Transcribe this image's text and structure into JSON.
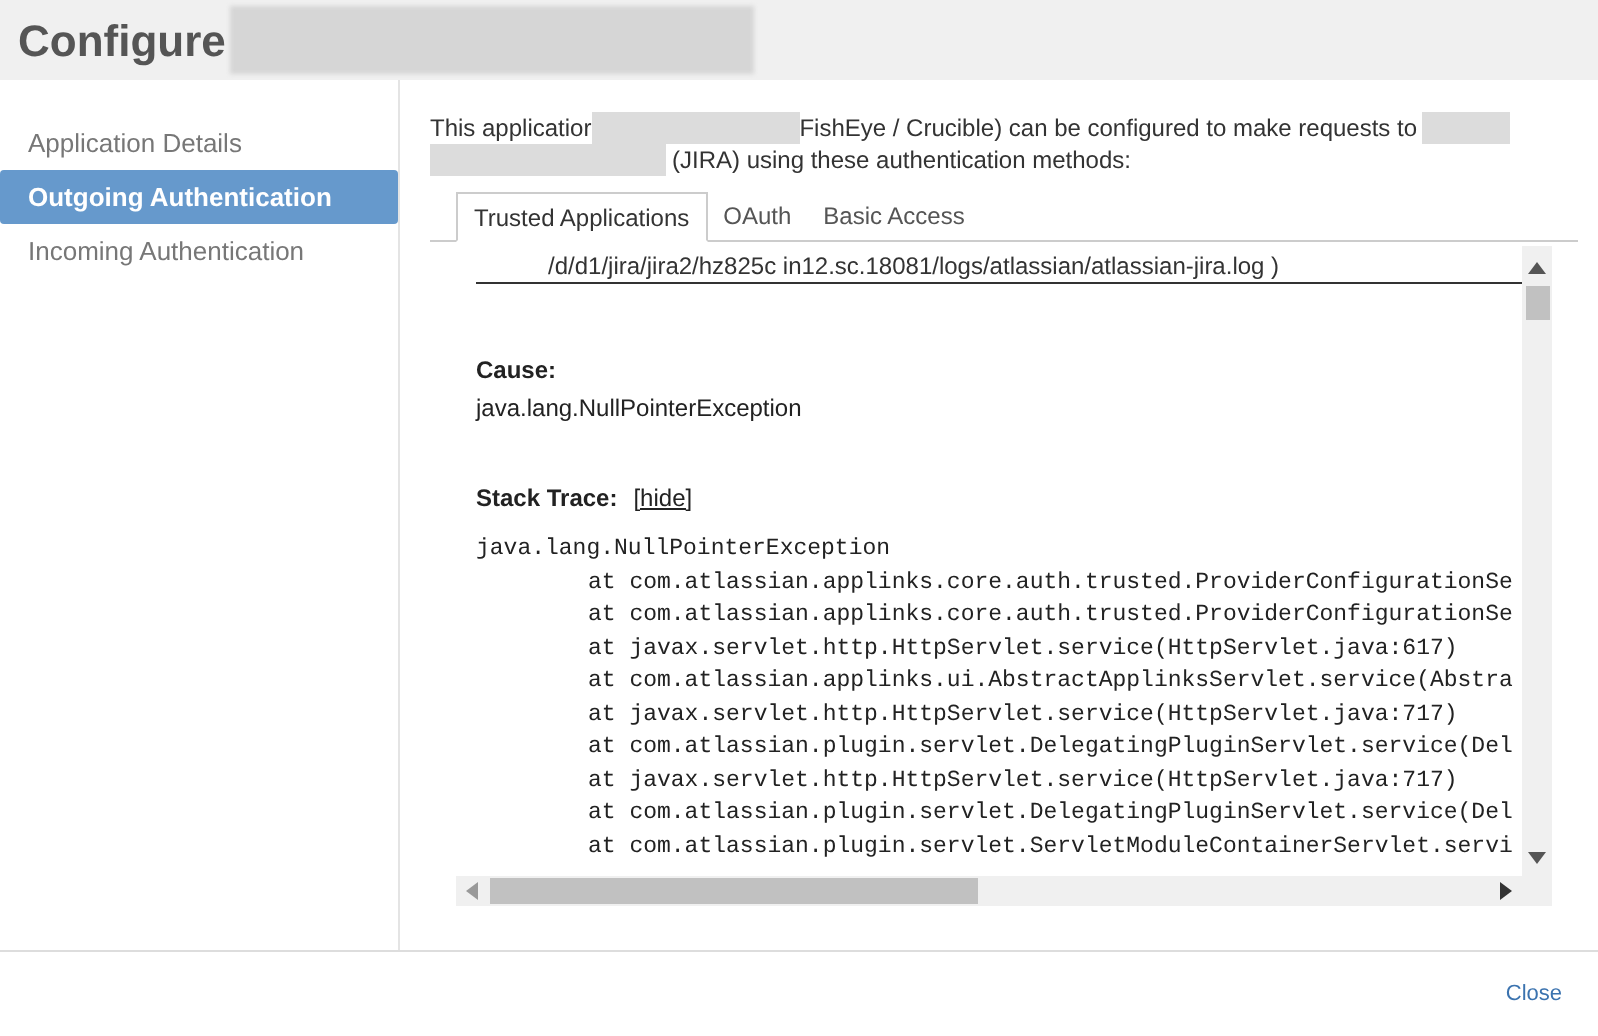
{
  "dialog": {
    "title": "Configure"
  },
  "sidebar": {
    "items": [
      {
        "label": "Application Details",
        "selected": false
      },
      {
        "label": "Outgoing Authentication",
        "selected": true
      },
      {
        "label": "Incoming Authentication",
        "selected": false
      }
    ]
  },
  "intro": {
    "parts": [
      "This applicatior",
      "FishEye / Crucible) can be configured to make requests to",
      "(JIRA) using these authentication methods:"
    ]
  },
  "tabs": [
    {
      "label": "Trusted Applications",
      "selected": true
    },
    {
      "label": "OAuth",
      "selected": false
    },
    {
      "label": "Basic Access",
      "selected": false
    }
  ],
  "error": {
    "log_path": "/d/d1/jira/jira2/hz825c in12.sc.18081/logs/atlassian/atlassian-jira.log )",
    "cause_label": "Cause:",
    "cause": "java.lang.NullPointerException",
    "stack_label": "Stack Trace:",
    "hide_link": "[hide]",
    "stack_lines": [
      {
        "kind": "head",
        "text": "java.lang.NullPointerException"
      },
      {
        "kind": "frame",
        "text": "at com.atlassian.applinks.core.auth.trusted.ProviderConfigurationSe"
      },
      {
        "kind": "frame",
        "text": "at com.atlassian.applinks.core.auth.trusted.ProviderConfigurationSe"
      },
      {
        "kind": "frame",
        "text": "at javax.servlet.http.HttpServlet.service(HttpServlet.java:617)"
      },
      {
        "kind": "frame",
        "text": "at com.atlassian.applinks.ui.AbstractApplinksServlet.service(Abstra"
      },
      {
        "kind": "frame",
        "text": "at javax.servlet.http.HttpServlet.service(HttpServlet.java:717)"
      },
      {
        "kind": "frame",
        "text": "at com.atlassian.plugin.servlet.DelegatingPluginServlet.service(Del"
      },
      {
        "kind": "frame",
        "text": "at javax.servlet.http.HttpServlet.service(HttpServlet.java:717)"
      },
      {
        "kind": "frame",
        "text": "at com.atlassian.plugin.servlet.DelegatingPluginServlet.service(Del"
      },
      {
        "kind": "frame",
        "text": "at com.atlassian.plugin.servlet.ServletModuleContainerServlet.servi"
      }
    ]
  },
  "footer": {
    "close": "Close"
  }
}
